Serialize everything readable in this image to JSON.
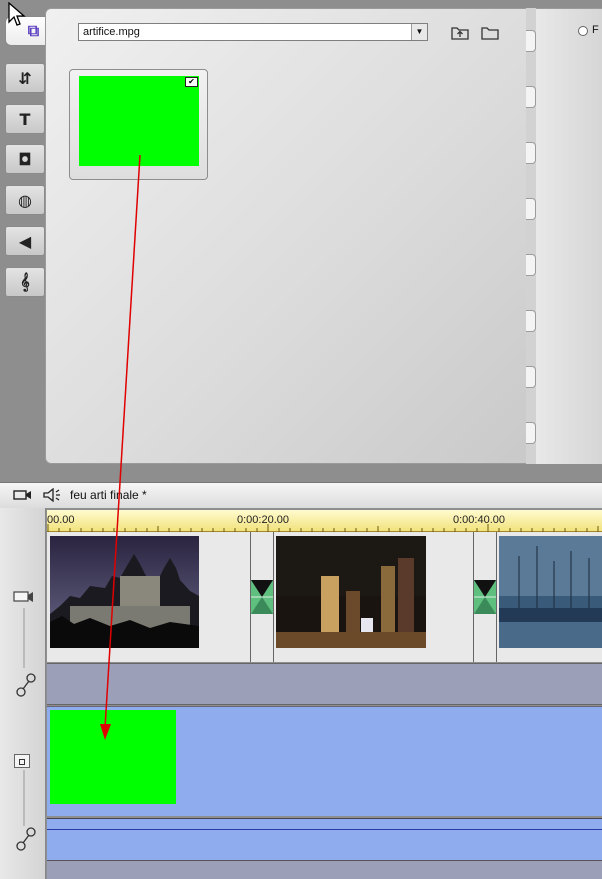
{
  "album": {
    "file_selector_value": "artifice.mpg",
    "radio_label_partial": "F",
    "tabs": [
      {
        "name": "video",
        "icon": "video-camera-icon"
      },
      {
        "name": "transitions",
        "icon": "transitions-icon"
      },
      {
        "name": "titles",
        "icon": "title-T-icon"
      },
      {
        "name": "still-images",
        "icon": "camera-icon"
      },
      {
        "name": "disc-menus",
        "icon": "disc-menu-icon"
      },
      {
        "name": "sound-effects",
        "icon": "speaker-icon"
      },
      {
        "name": "music",
        "icon": "treble-clef-icon"
      }
    ],
    "tab_glyphs": {
      "video": "⧉",
      "transitions": "⇵",
      "titles": "T",
      "still-images": "◘",
      "disc-menus": "◍",
      "sound-effects": "◀",
      "music": "𝄞"
    },
    "clip_thumbnail_color": "#00ff00"
  },
  "timeline": {
    "project_title": "feu arti finale *",
    "ruler_ticks": [
      "00.00",
      "0:00:20.00",
      "0:00:40.00"
    ],
    "video_clips": [
      {
        "name": "castle-night-clip",
        "description_colors": [
          "#2a2440",
          "#6a6a8a"
        ]
      },
      {
        "name": "city-night-clip",
        "description_colors": [
          "#1a1410",
          "#6b4a2a"
        ]
      },
      {
        "name": "harbor-dusk-clip",
        "description_colors": [
          "#3a5a7a",
          "#8aa0b8"
        ]
      }
    ],
    "overlay_clip_color": "#00ff00",
    "drag_arrow_color": "#e00000"
  },
  "colors": {
    "ruler": "#f2e27c",
    "overlay_track": "#8fadee",
    "audio_track": "#9c9fb8",
    "accent_purple": "#5a3fc0"
  }
}
